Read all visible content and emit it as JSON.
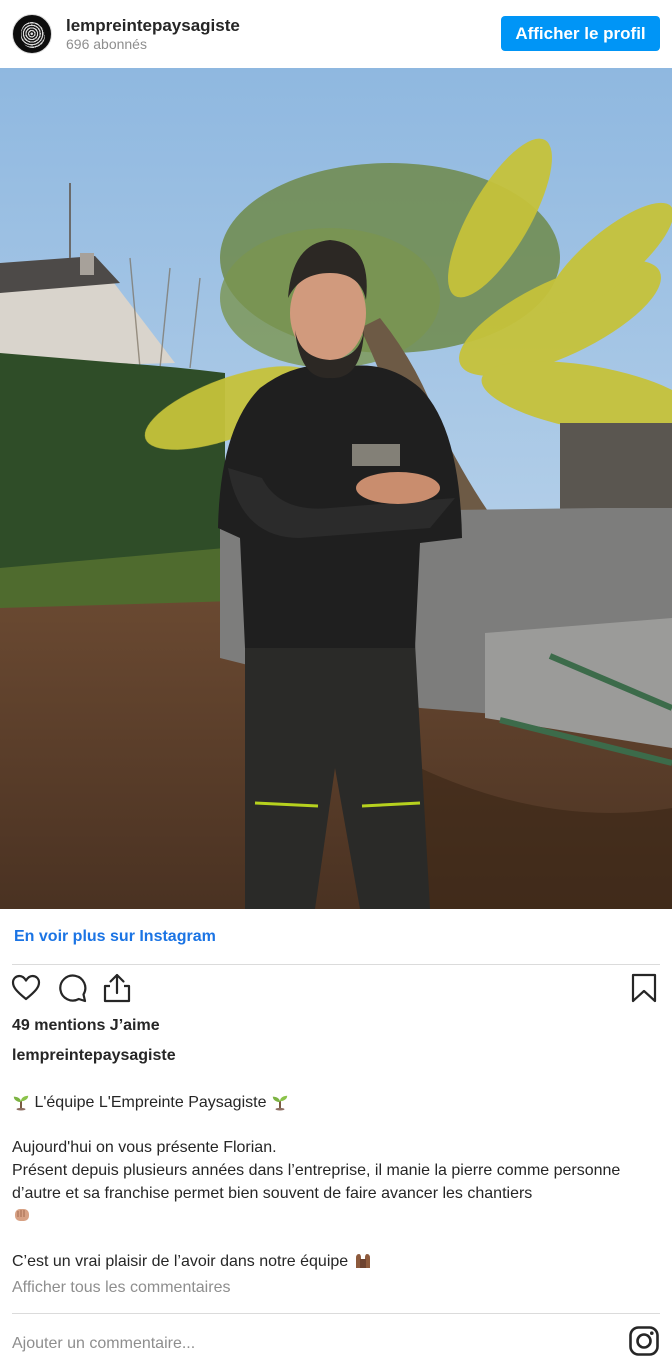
{
  "header": {
    "username": "lempreintepaysagiste",
    "followers": "696 abonnés",
    "profile_button": "Afficher le profil",
    "avatar_icon": "fingerprint-logo"
  },
  "post": {
    "more_link": "En voir plus sur Instagram",
    "likes": "49 mentions J’aime",
    "author": "lempreintepaysagiste",
    "caption": {
      "team_line": " L'équipe L'Empreinte Paysagiste ",
      "intro": "Aujourd'hui on vous présente Florian.",
      "body": "Présent depuis plusieurs années dans l’entreprise, il manie la pierre comme personne d’autre et sa franchise permet bien souvent de faire avancer les chantiers",
      "closing": "C’est un vrai plaisir de l’avoir dans notre équipe "
    },
    "view_all_comments": "Afficher tous les commentaires",
    "comment_placeholder": "Ajouter un commentaire..."
  },
  "icons": {
    "like": "heart-icon",
    "comment": "comment-icon",
    "share": "share-icon",
    "save": "bookmark-icon",
    "brand": "instagram-icon",
    "emoji_1": "seedling-emoji",
    "emoji_2": "fist-emoji",
    "emoji_3": "raised-hands-emoji"
  },
  "colors": {
    "accent": "#0095f6",
    "link": "#1b74e4",
    "text": "#262626",
    "muted": "#8e8e8e",
    "divider": "#dbdbdb"
  }
}
